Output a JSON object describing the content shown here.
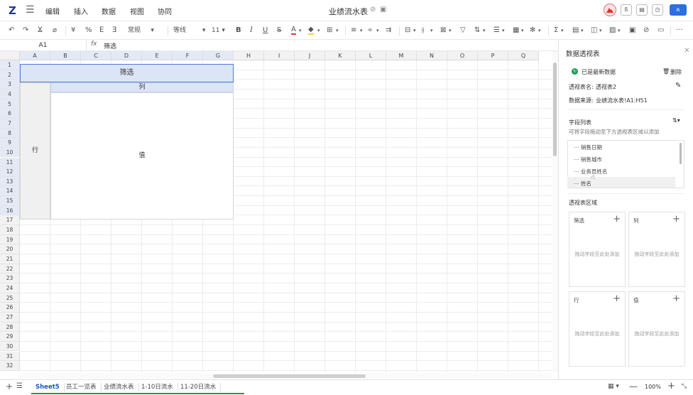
{
  "app": {
    "logo": "Z",
    "doc_title": "业绩流水表"
  },
  "menu": [
    "编辑",
    "插入",
    "数据",
    "视图",
    "协同"
  ],
  "toolbar": {
    "fmt": "常规",
    "font": "等线",
    "size": "11"
  },
  "formula_bar": {
    "cell_ref": "A1",
    "fx": "fx",
    "content": "筛选"
  },
  "columns": [
    "A",
    "B",
    "C",
    "D",
    "E",
    "F",
    "G",
    "H",
    "I",
    "J",
    "K",
    "L",
    "M",
    "N",
    "O",
    "P",
    "Q"
  ],
  "rows": [
    "1",
    "2",
    "3",
    "4",
    "5",
    "6",
    "7",
    "8",
    "9",
    "10",
    "11",
    "12",
    "13",
    "14",
    "15",
    "16",
    "17",
    "18",
    "19",
    "20",
    "21",
    "22",
    "23",
    "24",
    "25",
    "26",
    "27",
    "28",
    "29",
    "30",
    "31",
    "32"
  ],
  "pivot": {
    "filter": "筛选",
    "column": "列",
    "row": "行",
    "value": "值"
  },
  "panel": {
    "title": "数据透视表",
    "status": "已是最新数据",
    "delete": "删除",
    "name_label": "透视表名:",
    "name_value": "透视表2",
    "source_label": "数据来源:",
    "source_value": "业绩流水表!A1:H51",
    "field_list_title": "字段列表",
    "field_list_hint": "可将字段拖动至下方透视表区域以添加",
    "fields": [
      "销售日期",
      "销售城市",
      "业务员姓名",
      "姓名"
    ],
    "area_title": "透视表区域",
    "zones": [
      {
        "name": "筛选",
        "hint": "拖动字段至此处添加"
      },
      {
        "name": "列",
        "hint": "拖动字段至此处添加"
      },
      {
        "name": "行",
        "hint": "拖动字段至此处添加"
      },
      {
        "name": "值",
        "hint": "拖动字段至此处添加"
      }
    ]
  },
  "sheets": [
    "Sheet5",
    "员工一览表",
    "业绩流水表",
    "1-10日流水",
    "11-20日流水"
  ],
  "zoom": "100%",
  "colors": {
    "accent": "#1a56c4",
    "selection": "#4a7cd8",
    "pivot_fill": "#dbe5f6",
    "active_tab_underline": "#1e9a55"
  }
}
